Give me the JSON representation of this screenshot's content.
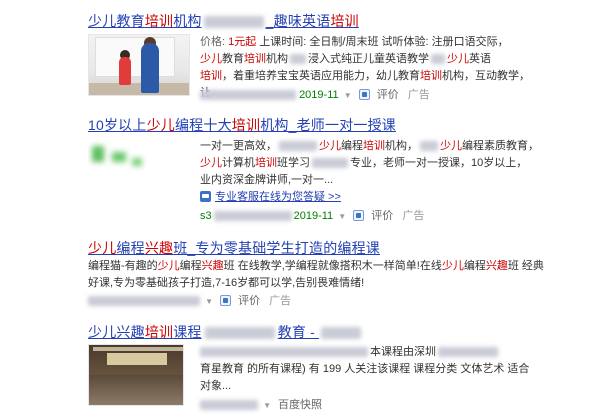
{
  "results": [
    {
      "title_parts": [
        {
          "t": "少儿教育",
          "hl": false
        },
        {
          "t": "培训",
          "hl": true
        },
        {
          "t": "机构",
          "hl": false
        },
        {
          "t": "_",
          "hl": false
        },
        {
          "t": "趣味英语",
          "hl": false
        },
        {
          "t": "培训",
          "hl": true
        }
      ],
      "lines": [
        [
          {
            "t": "价格: ",
            "c": "muted"
          },
          {
            "t": "1元起",
            "c": "hl"
          },
          {
            "t": "     上课时间: 全日制/周末班     试听体验: 注册口语交际，",
            "c": ""
          }
        ],
        [
          {
            "t": "少儿",
            "c": "hl"
          },
          {
            "t": "教育",
            "c": ""
          },
          {
            "t": "培训",
            "c": "hl"
          },
          {
            "t": "机构",
            "c": ""
          },
          {
            "t": "浸入式纯正儿童英语教学",
            "c": ""
          },
          {
            "t": "少儿",
            "c": "hl"
          },
          {
            "t": "英语",
            "c": ""
          }
        ],
        [
          {
            "t": "培训",
            "c": "hl"
          },
          {
            "t": "，着重培养宝宝英语应用能力，幼儿教育",
            "c": ""
          },
          {
            "t": "培训",
            "c": "hl"
          },
          {
            "t": "机构，互动教学，让",
            "c": ""
          }
        ]
      ],
      "meta": {
        "date": "2019-11",
        "feedback": "评价",
        "ad": "广告"
      }
    },
    {
      "title_parts": [
        {
          "t": "10岁以上",
          "hl": false
        },
        {
          "t": "少儿",
          "hl": true
        },
        {
          "t": "编程十大",
          "hl": false
        },
        {
          "t": "培训",
          "hl": true
        },
        {
          "t": "机构_老师一对一授课",
          "hl": false
        }
      ],
      "lines": [
        [
          {
            "t": "一对一更高效，",
            "c": ""
          },
          {
            "t": "少儿",
            "c": "hl"
          },
          {
            "t": "编程",
            "c": ""
          },
          {
            "t": "培训",
            "c": "hl"
          },
          {
            "t": "机构，",
            "c": ""
          },
          {
            "t": "少儿",
            "c": "hl"
          },
          {
            "t": "编程素质教育，",
            "c": ""
          }
        ],
        [
          {
            "t": "少儿",
            "c": "hl"
          },
          {
            "t": "计算机",
            "c": ""
          },
          {
            "t": "培训",
            "c": "hl"
          },
          {
            "t": "班学习",
            "c": ""
          },
          {
            "t": "专业，老师一对一授课，10岁以上，",
            "c": ""
          }
        ],
        [
          {
            "t": "业内资深金牌讲师,一对一...",
            "c": ""
          }
        ]
      ],
      "ask_link": "专业客服在线为您答疑 >>",
      "meta": {
        "url_prefix": "s3",
        "date": "2019-11",
        "feedback": "评价",
        "ad": "广告"
      }
    },
    {
      "title_parts": [
        {
          "t": "少儿",
          "hl": true
        },
        {
          "t": "编程",
          "hl": false
        },
        {
          "t": "兴趣",
          "hl": true
        },
        {
          "t": "班_专为零基础学生打造的编程课",
          "hl": false
        }
      ],
      "lines": [
        [
          {
            "t": "编程猫-有趣的",
            "c": ""
          },
          {
            "t": "少儿",
            "c": "hl"
          },
          {
            "t": "编程",
            "c": ""
          },
          {
            "t": "兴趣",
            "c": "hl"
          },
          {
            "t": "班 在线教学,学编程就像搭积木一样简单!在线",
            "c": ""
          },
          {
            "t": "少儿",
            "c": "hl"
          },
          {
            "t": "编程",
            "c": ""
          },
          {
            "t": "兴趣",
            "c": "hl"
          },
          {
            "t": "班 经典",
            "c": ""
          }
        ],
        [
          {
            "t": "好课,专为零基础孩子打造,7-16岁都可以学,告别畏难情绪!",
            "c": ""
          }
        ]
      ],
      "meta": {
        "feedback": "评价",
        "ad": "广告"
      }
    },
    {
      "title_parts": [
        {
          "t": "少儿兴趣",
          "hl": false
        },
        {
          "t": "培训",
          "hl": true
        },
        {
          "t": "课程",
          "hl": false
        },
        {
          "t": "教育 - ",
          "hl": false
        }
      ],
      "lines": [
        [
          {
            "t": "本课程由深圳",
            "c": ""
          }
        ],
        [
          {
            "t": "育星教育 的所有课程) 有 199 人关注该课程 课程分类 文体艺术 适合",
            "c": ""
          }
        ],
        [
          {
            "t": "对象...",
            "c": ""
          }
        ]
      ],
      "meta": {
        "snapshot": "百度快照"
      }
    }
  ]
}
